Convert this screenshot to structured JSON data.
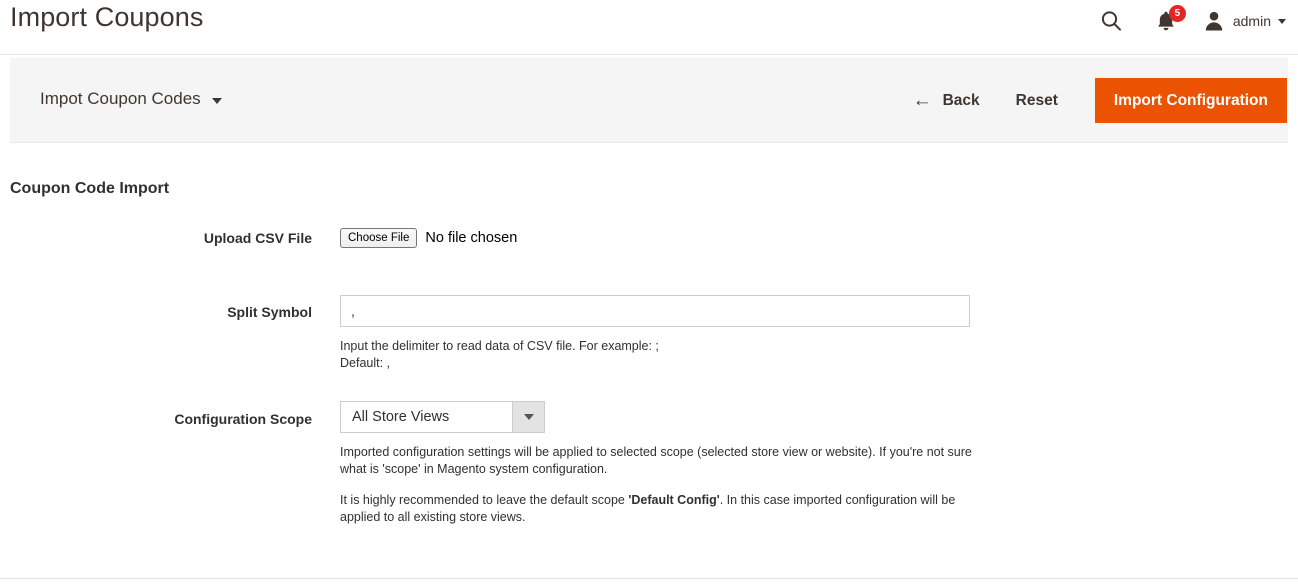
{
  "header": {
    "title": "Import Coupons",
    "search_icon": "search-icon",
    "notifications": {
      "icon": "bell-icon",
      "count": "5",
      "badge_color": "#e22626"
    },
    "user": {
      "avatar_icon": "user-avatar-icon",
      "name": "admin",
      "caret_icon": "chevron-down-icon"
    }
  },
  "toolbar": {
    "switcher_label": "Impot Coupon Codes",
    "switcher_caret_icon": "chevron-down-icon",
    "back_label": "Back",
    "back_icon": "arrow-left-icon",
    "reset_label": "Reset",
    "primary_label": "Import Configuration",
    "primary_color": "#eb5202",
    "background_color": "#f5f5f5"
  },
  "form": {
    "section_title": "Coupon Code Import",
    "upload": {
      "label": "Upload CSV File",
      "button_label": "Choose File",
      "status_text": "No file chosen"
    },
    "split_symbol": {
      "label": "Split Symbol",
      "value": ",",
      "placeholder": "",
      "note_line1": "Input the delimiter to read data of CSV file. For example: ;",
      "note_line2": "Default: ,"
    },
    "configuration_scope": {
      "label": "Configuration Scope",
      "selected": "All Store Views",
      "options": [
        "All Store Views"
      ],
      "arrow_icon": "chevron-down-icon",
      "note1": "Imported configuration settings will be applied to selected scope (selected store view or website). If you're not sure what is 'scope' in Magento system configuration.",
      "note2_before": "It is highly recommended to leave the default scope ",
      "note2_bold": "'Default Config'",
      "note2_after": ". In this case imported configuration will be applied to all existing store views."
    }
  }
}
